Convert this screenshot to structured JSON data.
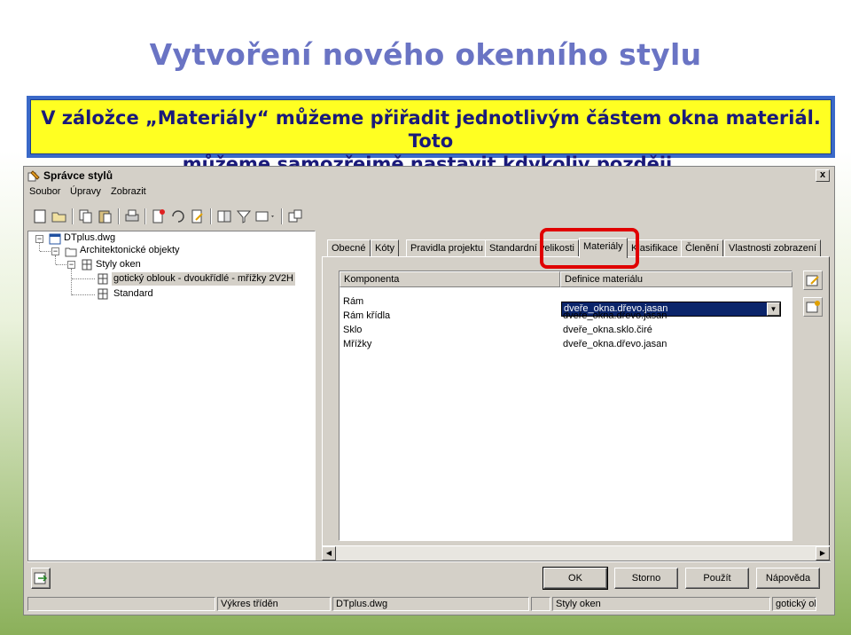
{
  "slide": {
    "title": "Vytvoření nového okenního stylu",
    "note_line1": "V záložce „Materiály“ můžeme přiřadit jednotlivým částem okna materiál. Toto",
    "note_line2": "můžeme samozřejmě nastavit kdykoliv později."
  },
  "window": {
    "title": "Správce stylů",
    "close": "x"
  },
  "menu": [
    "Soubor",
    "Úpravy",
    "Zobrazit"
  ],
  "toolbar_icons": [
    "new-icon",
    "open-icon",
    "copy-icon",
    "paste-icon",
    "print-icon",
    "new-style-icon",
    "purge-icon",
    "edit-icon",
    "toggle-view-icon",
    "filter-icon",
    "view-list-icon",
    "sync-icon"
  ],
  "tree": {
    "root": "DTplus.dwg",
    "folder": "Architektonické objekty",
    "styles": "Styly oken",
    "item_selected": "gotický oblouk - dvoukřídlé - mřížky 2V2H",
    "item_standard": "Standard"
  },
  "tabs": [
    "Obecné",
    "Kóty",
    "Pravidla projektu",
    "Standardní velikosti",
    "Materiály",
    "Klasifikace",
    "Členění",
    "Vlastnosti zobrazení"
  ],
  "active_tab": "Materiály",
  "grid": {
    "headers": [
      "Komponenta",
      "Definice materiálu"
    ],
    "rows": [
      {
        "component": "Rám",
        "material": "dveře_okna.dřevo.jasan"
      },
      {
        "component": "Rám křídla",
        "material": "dveře_okna.dřevo.jasan"
      },
      {
        "component": "Sklo",
        "material": "dveře_okna.sklo.čiré"
      },
      {
        "component": "Mřížky",
        "material": "dveře_okna.dřevo.jasan"
      }
    ]
  },
  "buttons": {
    "ok": "OK",
    "cancel": "Storno",
    "apply": "Použít",
    "help": "Nápověda"
  },
  "status": [
    "Výkres tříděn",
    "DTplus.dwg",
    "Styly oken",
    "gotický ob"
  ],
  "colors": {
    "highlight": "#e00000",
    "note_bg": "#ffff22",
    "title": "#6a74c4"
  }
}
